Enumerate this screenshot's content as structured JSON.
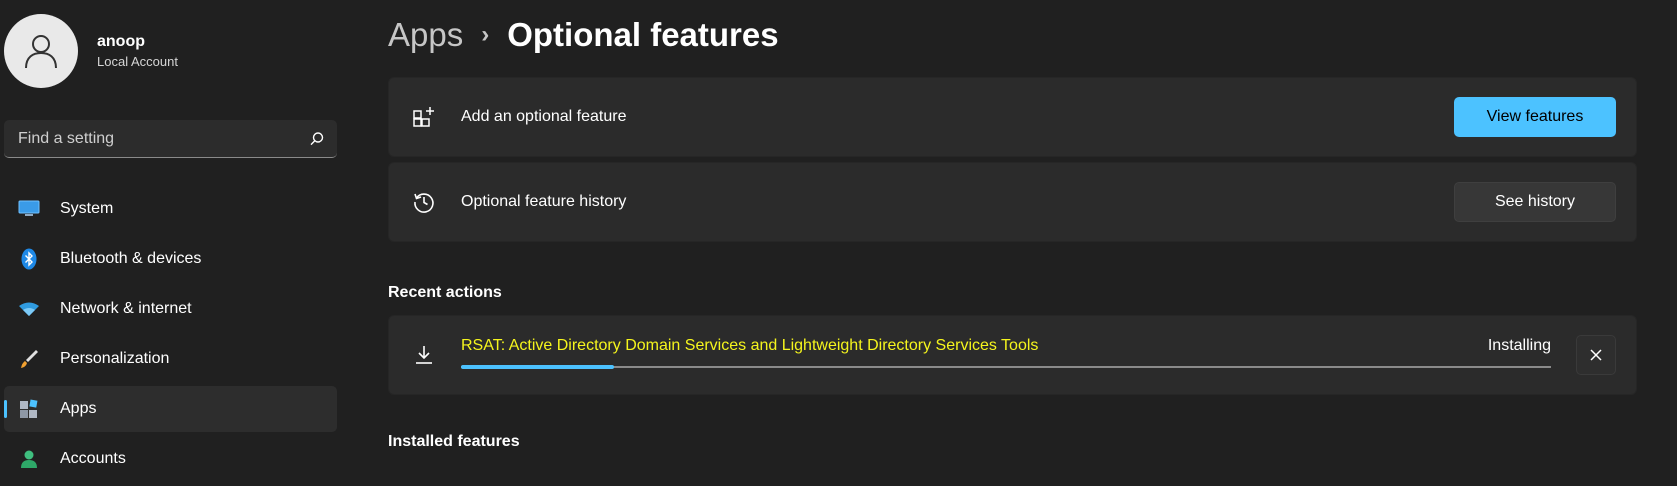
{
  "profile": {
    "name": "anoop",
    "account_type": "Local Account"
  },
  "search": {
    "placeholder": "Find a setting"
  },
  "nav": [
    {
      "label": "System",
      "icon": "monitor-icon"
    },
    {
      "label": "Bluetooth & devices",
      "icon": "bluetooth-icon"
    },
    {
      "label": "Network & internet",
      "icon": "wifi-icon"
    },
    {
      "label": "Personalization",
      "icon": "paintbrush-icon"
    },
    {
      "label": "Apps",
      "icon": "apps-icon",
      "active": true
    },
    {
      "label": "Accounts",
      "icon": "person-icon"
    }
  ],
  "breadcrumb": {
    "parent": "Apps",
    "separator": "›",
    "current": "Optional features"
  },
  "add_feature": {
    "label": "Add an optional feature",
    "button": "View features"
  },
  "history": {
    "label": "Optional feature history",
    "button": "See history"
  },
  "recent_actions": {
    "title": "Recent actions",
    "item": {
      "name": "RSAT: Active Directory Domain Services and Lightweight Directory Services Tools",
      "status": "Installing",
      "progress": 0.14
    }
  },
  "installed": {
    "title": "Installed features"
  },
  "colors": {
    "accent": "#4cc2ff",
    "background": "#202020",
    "card": "#2b2b2b",
    "highlight_text": "#f5f51d"
  }
}
